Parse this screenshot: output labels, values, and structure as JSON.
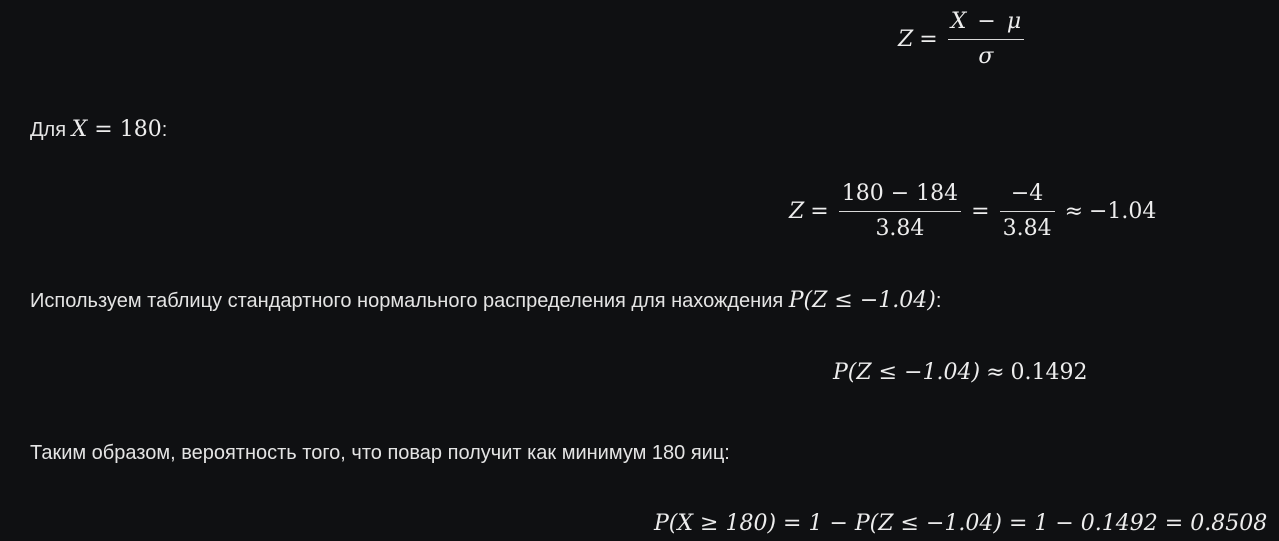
{
  "formula1": {
    "lhs": "Z",
    "rel": "=",
    "num_x": "X",
    "num_op": "−",
    "num_mu": "μ",
    "den": "σ"
  },
  "para1": {
    "text": "Для ",
    "math_var": "X",
    "math_rest": " = 180",
    "suffix": ":"
  },
  "formula2": {
    "lhs": "Z",
    "rel1": "=",
    "frac1_num": "180 − 184",
    "frac1_den": "3.84",
    "rel2": "=",
    "frac2_num": "−4",
    "frac2_den": "3.84",
    "rel3": "≈",
    "result": "−1.04"
  },
  "para2": {
    "text": "Используем таблицу стандартного нормального распределения для нахождения ",
    "math": "P(Z ≤ −1.04)",
    "suffix": ":"
  },
  "formula3": {
    "expr": "P(Z ≤ −1.04)",
    "rel": "≈",
    "value": "0.1492"
  },
  "para3": {
    "text": "Таким образом, вероятность того, что повар получит как минимум 180 яиц:"
  },
  "formula4": {
    "expr": "P(X ≥ 180) = 1 − P(Z ≤ −1.04) = 1 − 0.1492 = 0.8508"
  }
}
